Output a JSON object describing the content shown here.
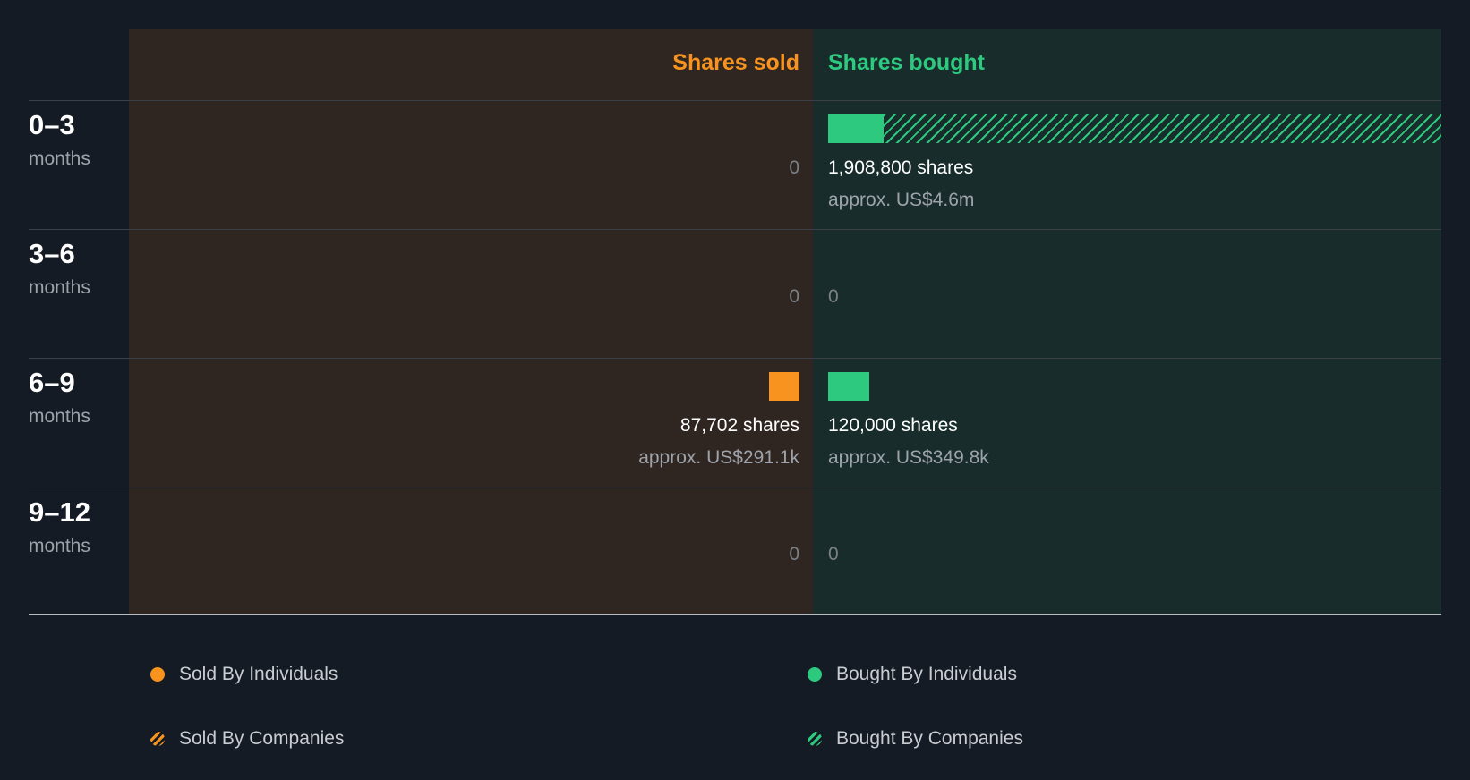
{
  "chart_data": {
    "type": "bar",
    "orientation": "horizontal-diverging",
    "headers": {
      "sold": "Shares sold",
      "bought": "Shares bought"
    },
    "categories": [
      {
        "num": "0–3",
        "unit": "months"
      },
      {
        "num": "3–6",
        "unit": "months"
      },
      {
        "num": "6–9",
        "unit": "months"
      },
      {
        "num": "9–12",
        "unit": "months"
      }
    ],
    "rows": [
      {
        "sold": {
          "individuals": 0,
          "companies": 0,
          "shares_label": "",
          "approx_label": "",
          "zero_label": "0"
        },
        "bought": {
          "individuals": 170000,
          "companies": 1738800,
          "shares_label": "1,908,800 shares",
          "approx_label": "approx. US$4.6m",
          "zero_label": ""
        }
      },
      {
        "sold": {
          "individuals": 0,
          "companies": 0,
          "shares_label": "",
          "approx_label": "",
          "zero_label": "0"
        },
        "bought": {
          "individuals": 0,
          "companies": 0,
          "shares_label": "",
          "approx_label": "",
          "zero_label": "0"
        }
      },
      {
        "sold": {
          "individuals": 87702,
          "companies": 0,
          "shares_label": "87,702 shares",
          "approx_label": "approx. US$291.1k",
          "zero_label": ""
        },
        "bought": {
          "individuals": 120000,
          "companies": 0,
          "shares_label": "120,000 shares",
          "approx_label": "approx. US$349.8k",
          "zero_label": ""
        }
      },
      {
        "sold": {
          "individuals": 0,
          "companies": 0,
          "shares_label": "",
          "approx_label": "",
          "zero_label": "0"
        },
        "bought": {
          "individuals": 0,
          "companies": 0,
          "shares_label": "",
          "approx_label": "",
          "zero_label": "0"
        }
      }
    ],
    "max_value": 1908800,
    "legend": [
      {
        "key": "sold_individuals",
        "label": "Sold By Individuals"
      },
      {
        "key": "bought_individuals",
        "label": "Bought By Individuals"
      },
      {
        "key": "sold_companies",
        "label": "Sold By Companies"
      },
      {
        "key": "bought_companies",
        "label": "Bought By Companies"
      }
    ],
    "colors": {
      "background": "#151b24",
      "sold": "#f7931e",
      "bought": "#2dc97e",
      "sold_panel": "#302621",
      "bought_panel": "#172c2b"
    }
  }
}
